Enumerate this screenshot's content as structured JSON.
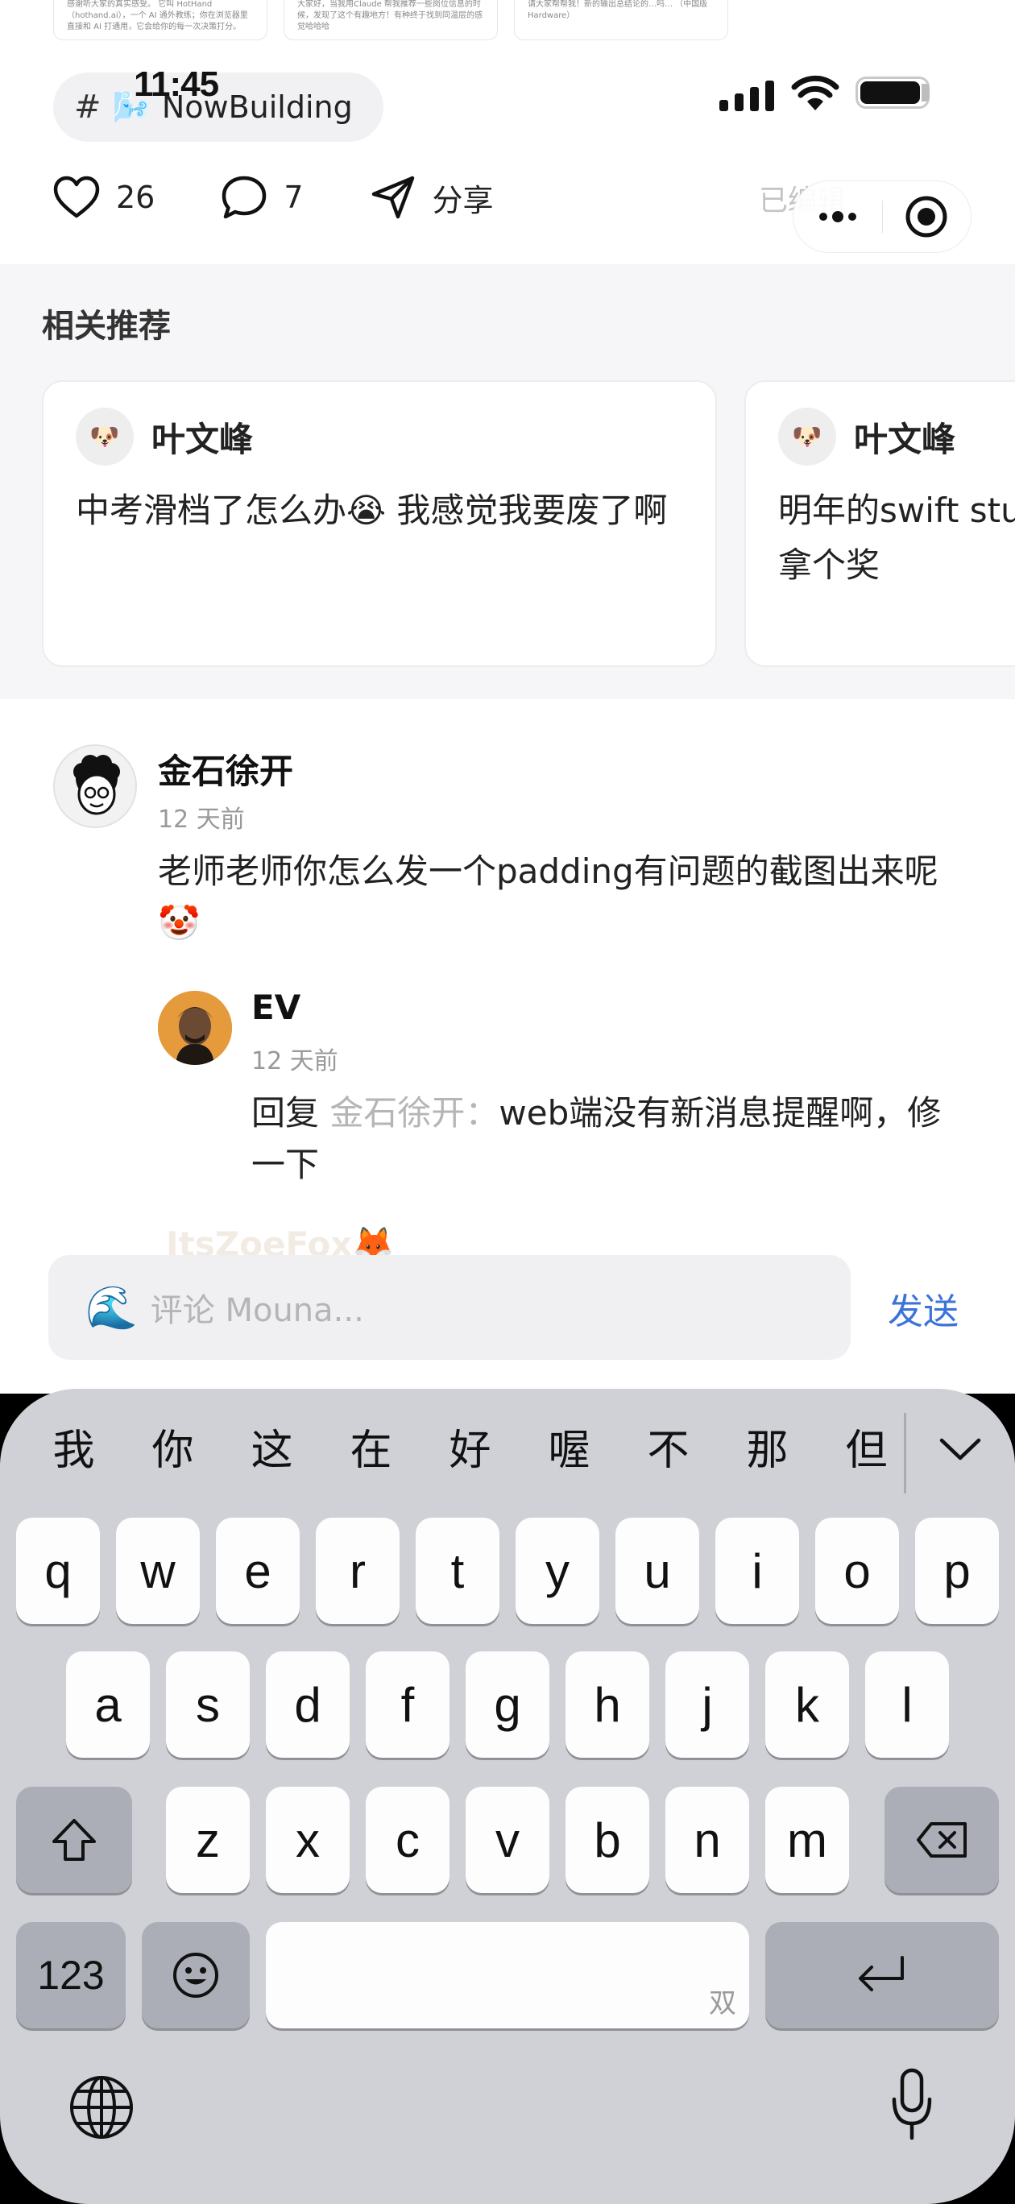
{
  "thumbs": [
    "感谢听大家的真实感受。 它叫 HotHand（hothand.ai），一个 AI 通外教练；你在浏览器里直接和 AI 打通用，它会给你的每一次决策打分。",
    "大家好，当我用Claude 帮我推荐一些岗位信息的时候，发现了这个有趣地方！有种终于找到同温层的感觉哈哈哈",
    "请大家帮帮我！新的输出总结论的…吗… （中国版Hardware）"
  ],
  "status_bar": {
    "time": "11:45"
  },
  "topic": {
    "hash": "#",
    "emoji": "🌬️",
    "label": "NowBuilding"
  },
  "actions": {
    "like_count": "26",
    "comment_count": "7",
    "share_label": "分享",
    "edited_label": "已编辑"
  },
  "related": {
    "title": "相关推荐",
    "cards": [
      {
        "author": "叶文峰",
        "avatar": "🐶",
        "text": "中考滑档了怎么办😭 我感觉我要废了啊"
      },
      {
        "author": "叶文峰",
        "avatar": "🐶",
        "text": "明年的swift student challenge，我得拿个奖"
      }
    ]
  },
  "comments": [
    {
      "author": "金石徐开",
      "time": "12 天前",
      "text": "老师老师你怎么发一个padding有问题的截图出来呢🤡"
    },
    {
      "author": "EV",
      "time": "12 天前",
      "reply_prefix": "回复 ",
      "reply_target": "金石徐开：",
      "text": "web端没有新消息提醒啊，修一下"
    }
  ],
  "ghost_comment": {
    "author": "ItsZoeFox🦊"
  },
  "input": {
    "placeholder": "评论 Mouna...",
    "avatar_emoji": "🌊",
    "send_label": "发送"
  },
  "keyboard": {
    "candidates": [
      "我",
      "你",
      "这",
      "在",
      "好",
      "喔",
      "不",
      "那",
      "但"
    ],
    "row1": [
      "q",
      "w",
      "e",
      "r",
      "t",
      "y",
      "u",
      "i",
      "o",
      "p"
    ],
    "row2": [
      "a",
      "s",
      "d",
      "f",
      "g",
      "h",
      "j",
      "k",
      "l"
    ],
    "row3": [
      "z",
      "x",
      "c",
      "v",
      "b",
      "n",
      "m"
    ],
    "numbers_label": "123",
    "space_hint": "双"
  }
}
